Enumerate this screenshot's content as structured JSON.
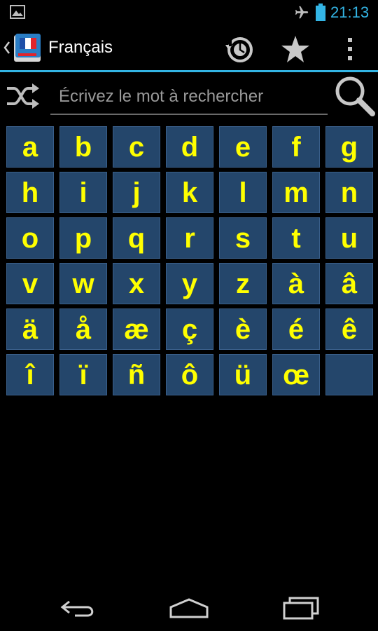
{
  "status_bar": {
    "time": "21:13",
    "icons": [
      "gallery-notification-icon",
      "airplane-mode-icon",
      "battery-icon"
    ]
  },
  "action_bar": {
    "title": "Français",
    "icons": [
      "up-chevron-icon",
      "french-dictionary-app-icon",
      "history-icon",
      "star-icon",
      "overflow-menu-icon"
    ]
  },
  "search": {
    "placeholder": "Écrivez le mot à rechercher",
    "value": ""
  },
  "letters": [
    "a",
    "b",
    "c",
    "d",
    "e",
    "f",
    "g",
    "h",
    "i",
    "j",
    "k",
    "l",
    "m",
    "n",
    "o",
    "p",
    "q",
    "r",
    "s",
    "t",
    "u",
    "v",
    "w",
    "x",
    "y",
    "z",
    "à",
    "â",
    "ä",
    "å",
    "æ",
    "ç",
    "è",
    "é",
    "ê",
    "î",
    "ï",
    "ñ",
    "ô",
    "ü",
    "œ",
    ""
  ],
  "colors": {
    "accent": "#33b5e5",
    "key_background": "#24466b",
    "key_text": "#ffff00",
    "background": "#000000"
  },
  "nav_bar": {
    "icons": [
      "back-icon",
      "home-icon",
      "recent-apps-icon"
    ]
  }
}
